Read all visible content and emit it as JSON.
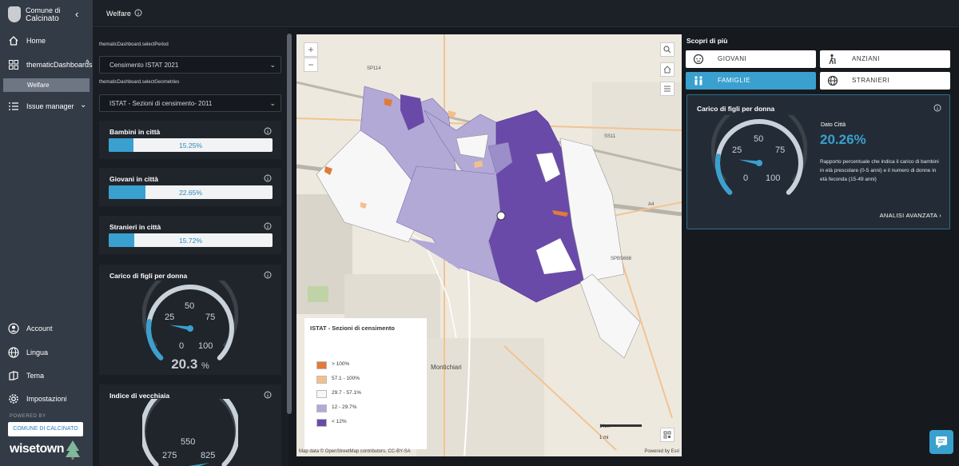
{
  "sidebar": {
    "brand_line1": "Comune di",
    "brand_line2": "Calcinato",
    "items": [
      {
        "label": "Home",
        "icon": "home-icon"
      },
      {
        "label": "thematicDashboards",
        "icon": "dashboard-icon"
      },
      {
        "label": "Issue manager",
        "icon": "list-icon"
      },
      {
        "label": "Account",
        "icon": "user-icon"
      },
      {
        "label": "Lingua",
        "icon": "globe-icon"
      },
      {
        "label": "Tema",
        "icon": "theme-icon"
      },
      {
        "label": "Impostazioni",
        "icon": "gear-icon"
      }
    ],
    "sub_item": "Welfare",
    "powered_by": "POWERED BY",
    "comune_button": "COMUNE DI CALCINATO",
    "logo": "wisetown"
  },
  "header": {
    "title": "Welfare"
  },
  "filters": {
    "period_label": "thematicDashboard.selectPeriod",
    "period_value": "Censimento ISTAT 2021",
    "geometries_label": "thematicDashboard.selectGeometries",
    "geometries_value": "ISTAT - Sezioni di censimento- 2011"
  },
  "stats": [
    {
      "title": "Bambini in città",
      "value": 15.25,
      "label": "15.25%"
    },
    {
      "title": "Giovani in città",
      "value": 22.65,
      "label": "22.65%"
    },
    {
      "title": "Stranieri in città",
      "value": 15.72,
      "label": "15.72%"
    }
  ],
  "gauge1": {
    "title": "Carico di figli per donna",
    "ticks": [
      "0",
      "25",
      "50",
      "75",
      "100"
    ],
    "value": 20.3,
    "value_text": "20.3",
    "unit": "%"
  },
  "gauge2": {
    "title": "Indice di vecchiaia",
    "ticks": [
      "275",
      "550",
      "825"
    ]
  },
  "map": {
    "legend_title": "ISTAT - Sezioni di censimento",
    "legend": [
      {
        "label": "> 100%",
        "color": "#e07b39"
      },
      {
        "label": "57.1 - 100%",
        "color": "#f3c08a"
      },
      {
        "label": "29.7 - 57.1%",
        "color": "#f7f7f7"
      },
      {
        "label": "12 - 29.7%",
        "color": "#b3a9d6"
      },
      {
        "label": "< 12%",
        "color": "#6a4aa8"
      }
    ],
    "places": [
      "Montichiari",
      "SP114",
      "SS11",
      "A4",
      "SPBS668"
    ],
    "scale_km": "1 km",
    "scale_mi": "1 mi",
    "attribution": "Map data © OpenStreetMap contributors, CC-BY-SA",
    "powered": "Powered by Esri"
  },
  "right": {
    "title": "Scopri di più",
    "tabs": [
      {
        "label": "GIOVANI",
        "icon": "baby-icon",
        "active": false
      },
      {
        "label": "ANZIANI",
        "icon": "elderly-icon",
        "active": false
      },
      {
        "label": "FAMIGLIE",
        "icon": "family-icon",
        "active": true
      },
      {
        "label": "STRANIERI",
        "icon": "globe-icon",
        "active": false
      }
    ],
    "detail": {
      "title": "Carico di figli per donna",
      "dato_label": "Dato Città",
      "dato_value": "20.26%",
      "gauge_value": 20.26,
      "ticks": [
        "0",
        "25",
        "50",
        "75",
        "100"
      ],
      "description": "Rapporto percentuale che indica il carico di bambini in età prescolare (0-5 anni) e il numero di donne in età feconda (15-49 anni)",
      "link": "ANALISI AVANZATA ›"
    }
  },
  "colors": {
    "accent": "#3aa0cf",
    "sidebar": "#333b46",
    "panel": "#20252c"
  }
}
